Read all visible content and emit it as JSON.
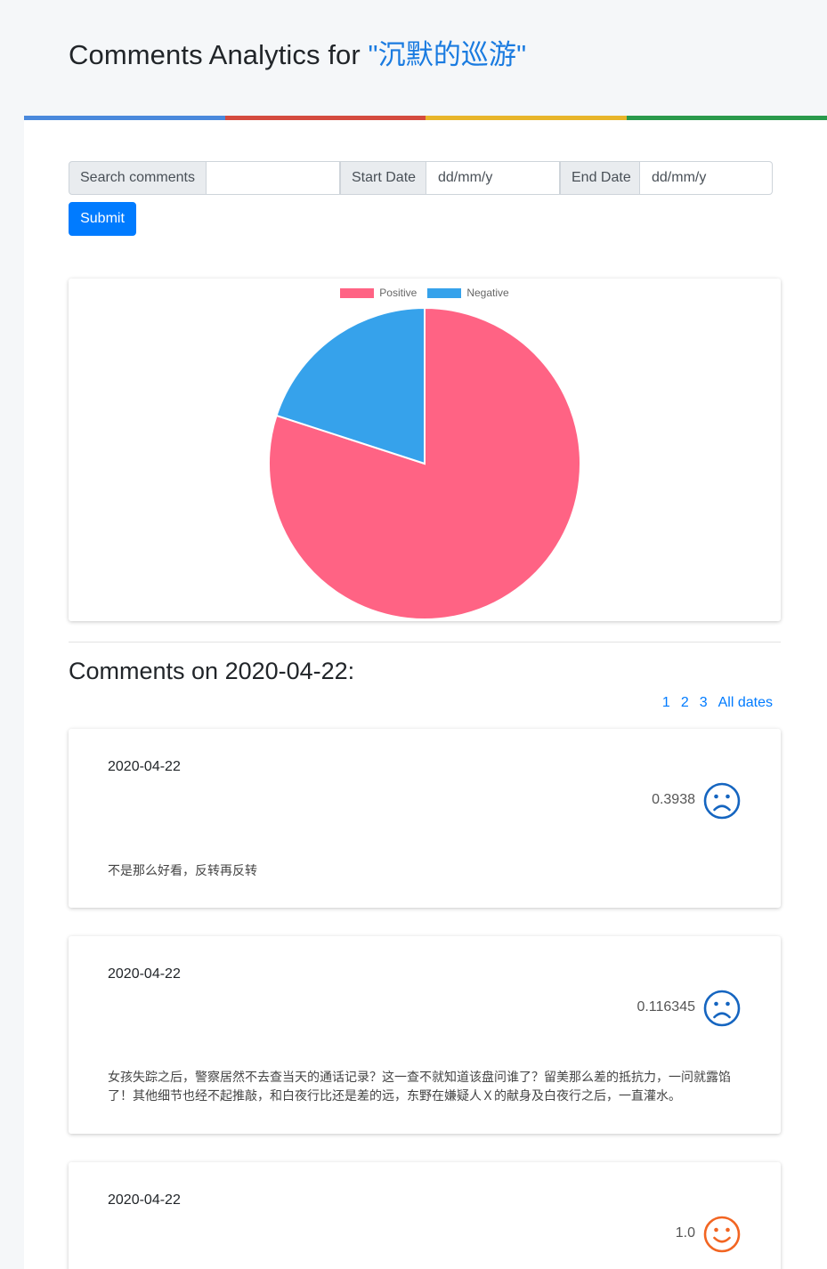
{
  "header": {
    "title_prefix": "Comments Analytics for ",
    "title_accent": "\"沉默的巡游\""
  },
  "color_bar": [
    "#4a89dc",
    "#d44b3f",
    "#e8b52a",
    "#2a9a4c"
  ],
  "search": {
    "search_label": "Search comments",
    "search_value": "",
    "start_label": "Start Date",
    "start_placeholder": "dd/mm/y",
    "end_label": "End Date",
    "end_placeholder": "dd/mm/y",
    "submit_label": "Submit"
  },
  "chart_data": {
    "type": "pie",
    "categories": [
      "Positive",
      "Negative"
    ],
    "values": [
      80,
      20
    ],
    "colors": [
      "#ff6384",
      "#36a2eb"
    ],
    "legend": "top"
  },
  "comments_section": {
    "title": "Comments on 2020-04-22:",
    "pages": [
      "1",
      "2",
      "3"
    ],
    "all_dates": "All dates"
  },
  "comments": [
    {
      "date": "2020-04-22",
      "score": "0.3938",
      "sentiment": "sad-face-icon",
      "color": "#1565c0",
      "text": "不是那么好看，反转再反转"
    },
    {
      "date": "2020-04-22",
      "score": "0.116345",
      "sentiment": "sad-face-icon",
      "color": "#1565c0",
      "text": "女孩失踪之后，警察居然不去查当天的通话记录？这一查不就知道该盘问谁了？留美那么差的抵抗力，一问就露馅了！其他细节也经不起推敲，和白夜行比还是差的远，东野在嫌疑人Ｘ的献身及白夜行之后，一直灌水。"
    },
    {
      "date": "2020-04-22",
      "score": "1.0",
      "sentiment": "smile-face-icon",
      "color": "#f26522",
      "text": ""
    }
  ]
}
